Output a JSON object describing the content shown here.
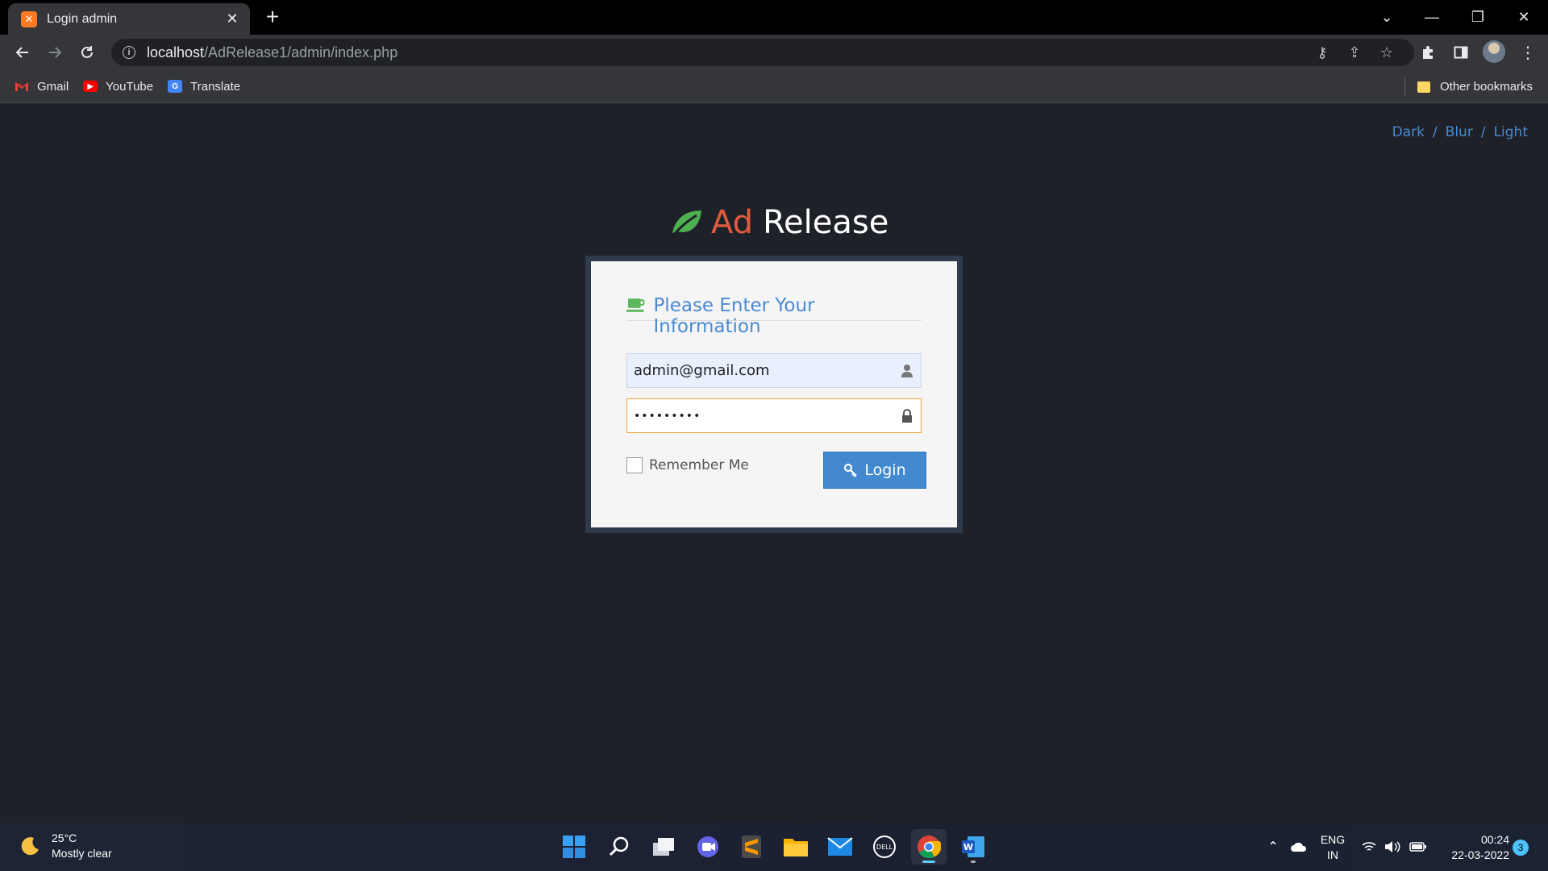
{
  "browser": {
    "tab_title": "Login admin",
    "url_host": "localhost",
    "url_path": "/AdRelease1/admin/index.php",
    "bookmarks": [
      {
        "label": "Gmail"
      },
      {
        "label": "YouTube"
      },
      {
        "label": "Translate"
      }
    ],
    "other_bookmarks": "Other bookmarks"
  },
  "page": {
    "themes": {
      "dark": "Dark",
      "blur": "Blur",
      "light": "Light",
      "separator": "/"
    },
    "brand": {
      "ad": "Ad",
      "release": "Release",
      "leaf_color": "#4caf50",
      "ad_color": "#e05a3f"
    },
    "login": {
      "heading": "Please Enter Your Information",
      "email_value": "admin@gmail.com",
      "password_value": "•••••••••",
      "remember_label": "Remember Me",
      "remember_checked": false,
      "login_button": "Login",
      "accent_color": "#4289cf"
    }
  },
  "taskbar": {
    "weather_temp": "25°C",
    "weather_desc": "Mostly clear",
    "lang_line1": "ENG",
    "lang_line2": "IN",
    "time": "00:24",
    "date": "22-03-2022",
    "notification_count": "3"
  }
}
